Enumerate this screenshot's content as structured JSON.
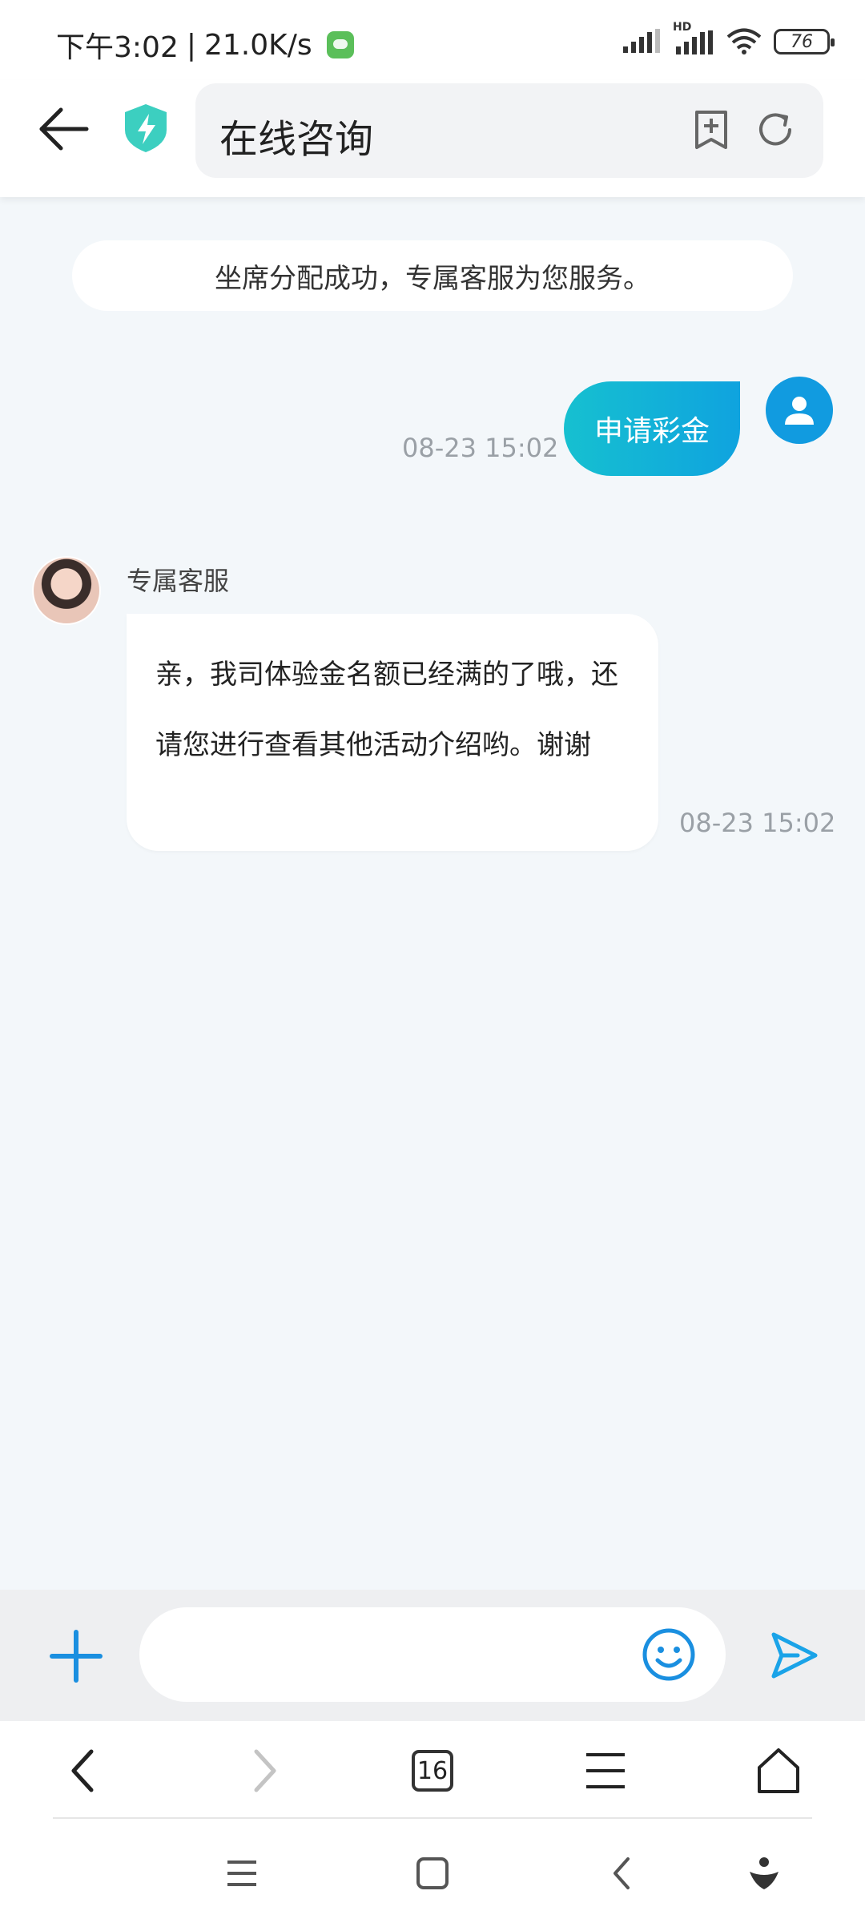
{
  "status_bar": {
    "time": "下午3:02",
    "separator": "|",
    "network_speed": "21.0K/s",
    "app_badge_icon": "pdf-app-icon",
    "signal_label": "HD",
    "battery": "76"
  },
  "header": {
    "title": "在线咨询",
    "back_icon": "arrow-left-icon",
    "shield_icon": "shield-bolt-icon",
    "bookmark_icon": "bookmark-add-icon",
    "refresh_icon": "refresh-icon"
  },
  "chat": {
    "system_message": "坐席分配成功，专属客服为您服务。",
    "messages": [
      {
        "sender": "user",
        "text": "申请彩金",
        "time": "08-23 15:02"
      },
      {
        "sender": "agent",
        "name": "专属客服",
        "text": "亲，我司体验金名额已经满的了哦，还请您进行查看其他活动介绍哟。谢谢",
        "time": "08-23 15:02"
      }
    ]
  },
  "input_bar": {
    "placeholder": "",
    "plus_icon": "plus-icon",
    "emoji_icon": "smiley-icon",
    "send_icon": "send-icon"
  },
  "browser_nav": {
    "tab_count": "16"
  },
  "colors": {
    "accent": "#119be0",
    "user_bubble_start": "#16c0d0",
    "user_bubble_end": "#0fa3df",
    "shield": "#3ccfc0",
    "chat_bg": "#f3f7fa"
  }
}
